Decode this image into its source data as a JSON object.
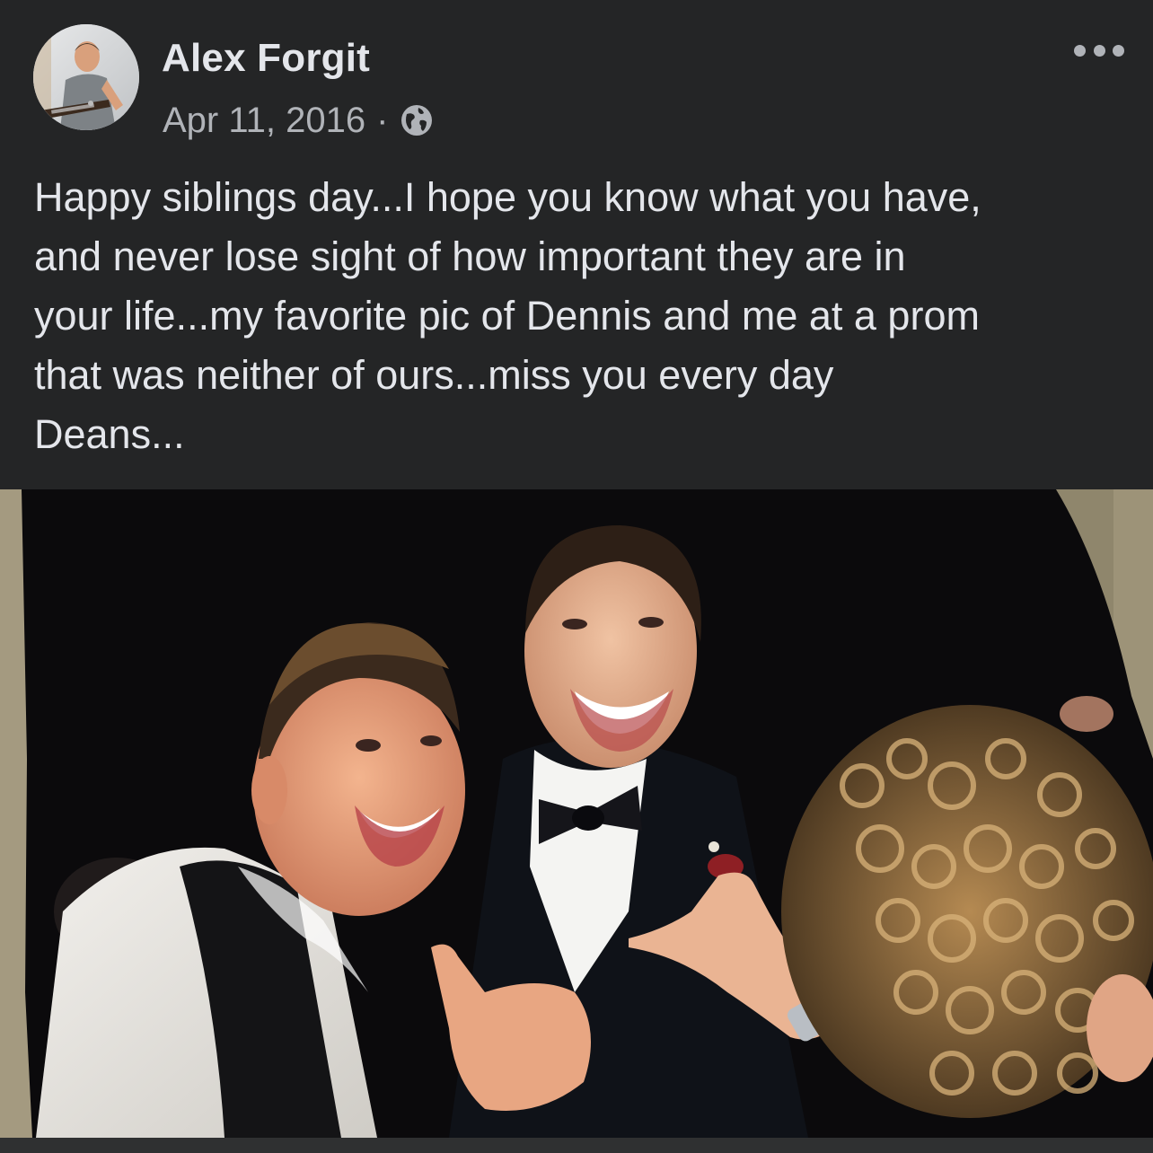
{
  "post": {
    "author": "Alex Forgit",
    "date": "Apr 11, 2016",
    "separator": "·",
    "privacy_icon": "globe-icon",
    "more_icon": "more-options-icon",
    "text_lines": [
      "Happy siblings day...I hope you know what you have,",
      "and never lose sight of how important they are in",
      "your life...my favorite pic of Dennis and me at a prom",
      "that was neither of ours...miss you every day",
      "Deans..."
    ]
  },
  "colors": {
    "background": "#242526",
    "primary_text": "#e4e6eb",
    "secondary_text": "#b0b3b8"
  }
}
